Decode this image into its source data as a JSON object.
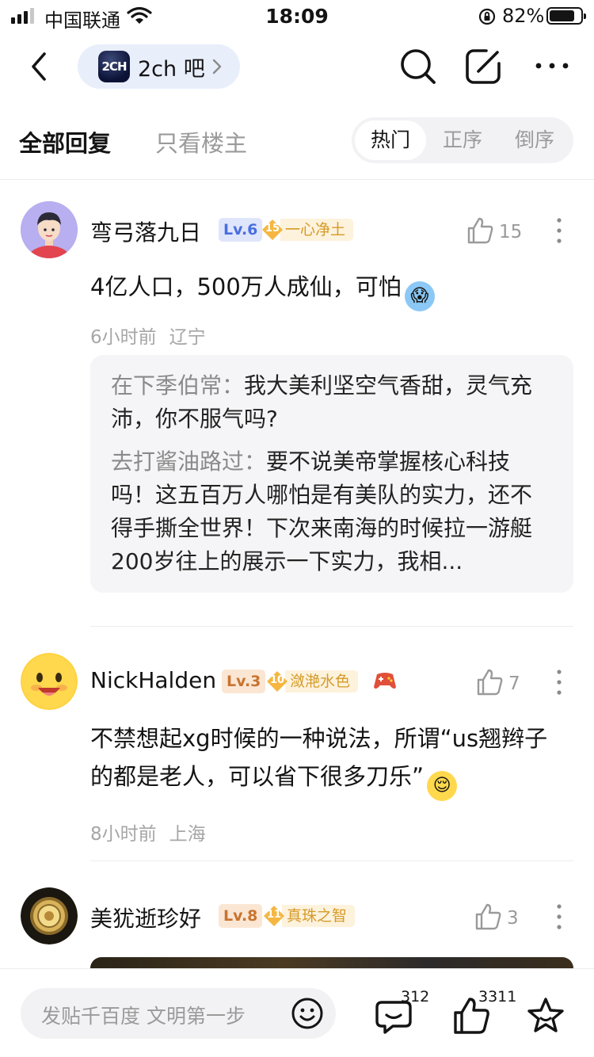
{
  "status_bar": {
    "carrier": "中国联通",
    "time": "18:09",
    "battery_percent": "82%",
    "battery_level": 0.82
  },
  "nav": {
    "forum_logo_text": "2CH",
    "forum_name": "2ch 吧"
  },
  "tabs": {
    "all_replies": "全部回复",
    "only_op": "只看楼主",
    "sort_options": [
      "热门",
      "正序",
      "倒序"
    ],
    "active_sort": "热门"
  },
  "comments": [
    {
      "username": "弯弓落九日",
      "level": "Lv.6",
      "tag_level": "15",
      "tag_name": "一心净土",
      "likes": "15",
      "content": "4亿人口，500万人成仙，可怕",
      "emoji": "😱",
      "time": "6小时前",
      "location": "辽宁",
      "sub_replies": [
        {
          "author": "在下季伯常：",
          "text": "我大美利坚空气香甜，灵气充沛，你不服气吗?"
        },
        {
          "author": "去打酱油路过：",
          "text": "要不说美帝掌握核心科技吗！这五百万人哪怕是有美队的实力，还不得手撕全世界！下次来南海的时候拉一游艇200岁往上的展示一下实力，我相..."
        }
      ]
    },
    {
      "username": "NickHalden",
      "level": "Lv.3",
      "tag_level": "10",
      "tag_name": "潋滟水色",
      "likes": "7",
      "content": "不禁想起xg时候的一种说法，所谓“us翘辫子的都是老人，可以省下很多刀乐”",
      "emoji": "😌",
      "time": "8小时前",
      "location": "上海"
    },
    {
      "username": "美犹逝珍好",
      "level": "Lv.8",
      "tag_level": "11",
      "tag_name": "真珠之智",
      "likes": "3"
    }
  ],
  "bottom_bar": {
    "input_placeholder": "发贴千百度 文明第一步",
    "comment_count": "312",
    "like_count": "3311"
  },
  "colors": {
    "accent_pill": "#e9eefb",
    "lv6": "#4a6ee0",
    "lv3": "#c8742f",
    "lv8": "#c8742f",
    "tag": "#d69a28"
  }
}
